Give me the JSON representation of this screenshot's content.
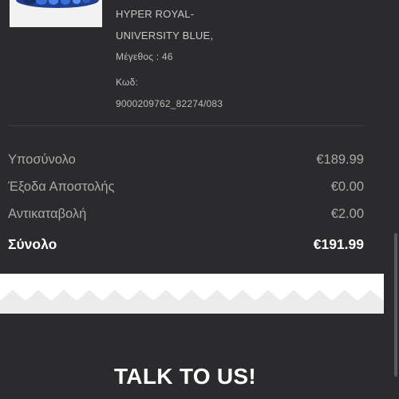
{
  "product": {
    "image_icon": "sneaker-thumbnail",
    "name_line1": "HYPER ROYAL-",
    "name_line2": "UNIVERSITY BLUE,",
    "size_text": "Μέγεθος : 46",
    "code_label": "Κωδ:",
    "code_value": "9000209762_82274/083"
  },
  "summary": {
    "subtotal_label": "Υποσύνολο",
    "subtotal_value": "€189.99",
    "shipping_label": "Έξοδα Αποστολής",
    "shipping_value": "€0.00",
    "cod_label": "Αντικαταβολή",
    "cod_value": "€2.00",
    "total_label": "Σύνολο",
    "total_value": "€191.99"
  },
  "footer": {
    "heading": "TALK TO US!"
  },
  "colors": {
    "background": "#2b2b2d",
    "zigzag_band": "#ffffff",
    "text_primary": "#ffffff",
    "text_secondary": "#a9a9a9"
  }
}
